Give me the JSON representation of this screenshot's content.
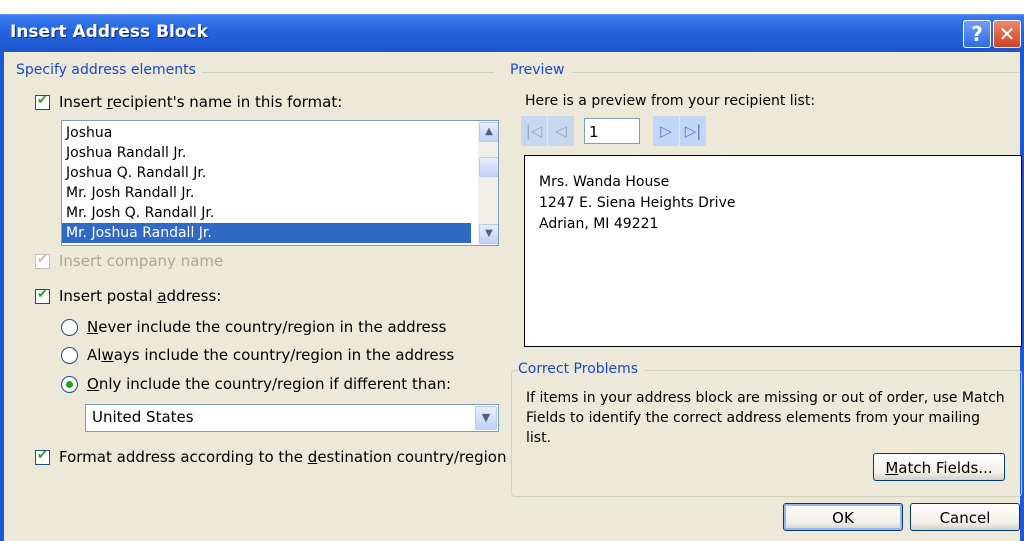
{
  "dialog": {
    "title": "Insert Address Block",
    "help_label": "?",
    "close_label": "✕"
  },
  "left": {
    "group_label": "Specify address elements",
    "recipient_name": {
      "label_pre": "Insert ",
      "label_key": "r",
      "label_post": "ecipient's name in this format:",
      "checked": true,
      "formats": [
        "Joshua",
        "Joshua Randall Jr.",
        "Joshua Q. Randall Jr.",
        "Mr. Josh Randall Jr.",
        "Mr. Josh Q. Randall Jr.",
        "Mr. Joshua Randall Jr."
      ],
      "selected_format": "Mr. Joshua Randall Jr."
    },
    "company": {
      "label": "Insert company name",
      "checked": true,
      "enabled": false
    },
    "postal": {
      "label_pre": "Insert postal ",
      "label_key": "a",
      "label_post": "ddress:",
      "checked": true,
      "never_pre": "",
      "never_key": "N",
      "never_post": "ever include the country/region in the address",
      "always_pre": "Al",
      "always_key": "w",
      "always_post": "ays include the country/region in the address",
      "only_pre": "",
      "only_key": "O",
      "only_post": "nly include the country/region if different than:",
      "selected_option": "only",
      "country": "United States"
    },
    "format_dest": {
      "label_pre": "Format address according to the ",
      "label_key": "d",
      "label_post": "estination country/region",
      "checked": true
    }
  },
  "right": {
    "group_label": "Preview",
    "intro": "Here is a preview from your recipient list:",
    "record": "1",
    "address_lines": [
      "Mrs. Wanda House",
      "1247 E. Siena Heights Drive",
      "Adrian, MI 49221"
    ],
    "correct_problems": {
      "label": "Correct Problems",
      "text": "If items in your address block are missing or out of order, use Match Fields to identify the correct address elements from your mailing list.",
      "match_pre": "",
      "match_key": "M",
      "match_post": "atch Fields..."
    }
  },
  "buttons": {
    "ok": "OK",
    "cancel": "Cancel"
  },
  "icons": {
    "scroll_up": "▲",
    "scroll_down": "▼",
    "dropdown": "▼",
    "first": "|◁",
    "prev": "◁",
    "next": "▷",
    "last": "▷|"
  }
}
